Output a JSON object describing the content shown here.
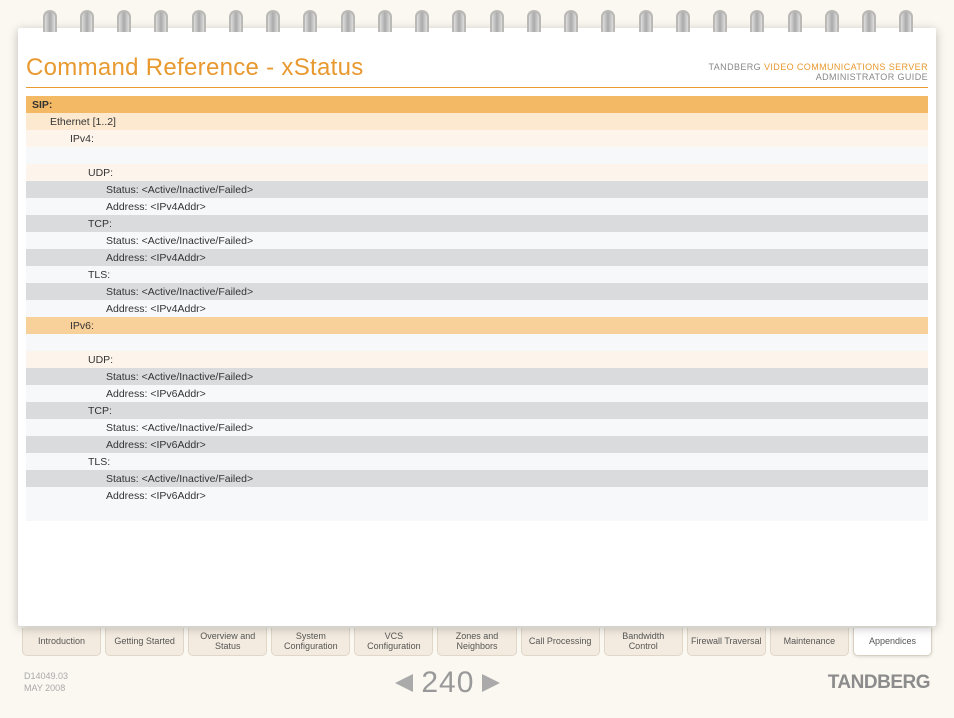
{
  "header": {
    "title": "Command Reference - xStatus",
    "brand": "TANDBERG",
    "product": "VIDEO COMMUNICATIONS SERVER",
    "subtitle": "ADMINISTRATOR GUIDE"
  },
  "rows": [
    {
      "text": "SIP:",
      "cls": "bg-dkorange lvl0"
    },
    {
      "text": "Ethernet [1..2]",
      "cls": "bg-ltorange lvl1"
    },
    {
      "text": "IPv4:",
      "cls": "bg-cream lvl2"
    },
    {
      "text": "",
      "cls": "bg-ltblue lvl3"
    },
    {
      "text": "UDP:",
      "cls": "bg-cream lvl3"
    },
    {
      "text": "Status: <Active/Inactive/Failed>",
      "cls": "bg-grey lvl4"
    },
    {
      "text": "Address: <IPv4Addr>",
      "cls": "bg-ltblue lvl4"
    },
    {
      "text": "TCP:",
      "cls": "bg-grey lvl3"
    },
    {
      "text": "Status: <Active/Inactive/Failed>",
      "cls": "bg-ltblue lvl4"
    },
    {
      "text": "Address: <IPv4Addr>",
      "cls": "bg-grey lvl4"
    },
    {
      "text": "TLS:",
      "cls": "bg-ltblue lvl3"
    },
    {
      "text": "Status: <Active/Inactive/Failed>",
      "cls": "bg-grey lvl4"
    },
    {
      "text": "Address: <IPv4Addr>",
      "cls": "bg-ltblue lvl4"
    },
    {
      "text": "IPv6:",
      "cls": "bg-mdorange lvl2"
    },
    {
      "text": "",
      "cls": "bg-ltblue lvl3"
    },
    {
      "text": "UDP:",
      "cls": "bg-cream lvl3"
    },
    {
      "text": "Status: <Active/Inactive/Failed>",
      "cls": "bg-grey lvl4"
    },
    {
      "text": "Address: <IPv6Addr>",
      "cls": "bg-ltblue lvl4"
    },
    {
      "text": "TCP:",
      "cls": "bg-grey lvl3"
    },
    {
      "text": "Status: <Active/Inactive/Failed>",
      "cls": "bg-ltblue lvl4"
    },
    {
      "text": "Address: <IPv6Addr>",
      "cls": "bg-grey lvl4"
    },
    {
      "text": "TLS:",
      "cls": "bg-ltblue lvl3"
    },
    {
      "text": "Status: <Active/Inactive/Failed>",
      "cls": "bg-grey lvl4"
    },
    {
      "text": "Address: <IPv6Addr>",
      "cls": "bg-ltblue lvl4"
    },
    {
      "text": "",
      "cls": "bg-ltblue lvl0"
    }
  ],
  "tabs": [
    {
      "label": "Introduction",
      "active": false
    },
    {
      "label": "Getting Started",
      "active": false
    },
    {
      "label": "Overview and Status",
      "active": false
    },
    {
      "label": "System Configuration",
      "active": false
    },
    {
      "label": "VCS Configuration",
      "active": false
    },
    {
      "label": "Zones and Neighbors",
      "active": false
    },
    {
      "label": "Call Processing",
      "active": false
    },
    {
      "label": "Bandwidth Control",
      "active": false
    },
    {
      "label": "Firewall Traversal",
      "active": false
    },
    {
      "label": "Maintenance",
      "active": false
    },
    {
      "label": "Appendices",
      "active": true
    }
  ],
  "footer": {
    "doc": "D14049.03",
    "date": "MAY 2008",
    "page": "240",
    "logo": "TANDBERG"
  }
}
